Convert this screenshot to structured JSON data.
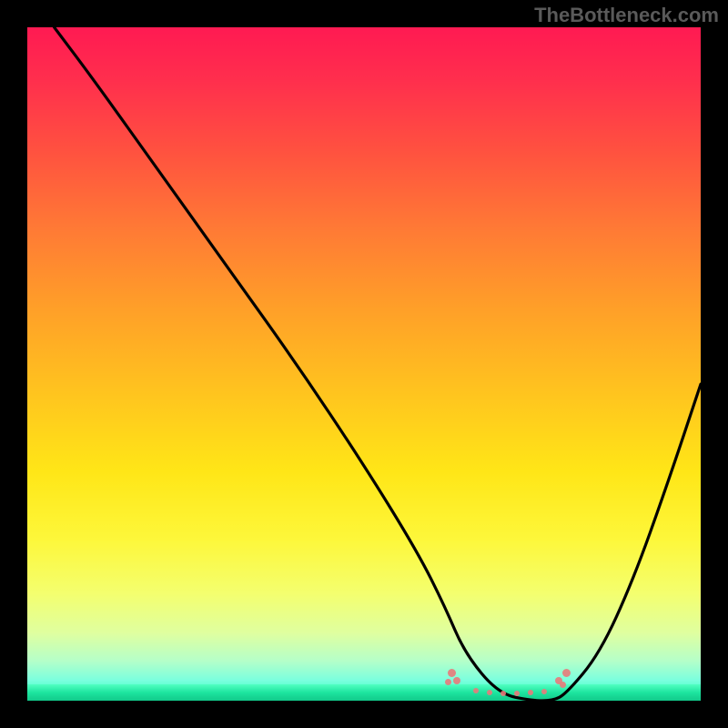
{
  "watermark": "TheBottleneck.com",
  "chart_data": {
    "type": "line",
    "title": "",
    "xlabel": "",
    "ylabel": "",
    "xlim": [
      0,
      100
    ],
    "ylim": [
      0,
      100
    ],
    "grid": false,
    "gradient": {
      "description": "Vertical gradient from red (top, high bottleneck) through orange, yellow to green (bottom, optimal)",
      "stops": [
        {
          "pos": 0,
          "color": "#ff1a52"
        },
        {
          "pos": 18,
          "color": "#ff5040"
        },
        {
          "pos": 42,
          "color": "#ffa028"
        },
        {
          "pos": 66,
          "color": "#ffe617"
        },
        {
          "pos": 84,
          "color": "#f4ff6e"
        },
        {
          "pos": 97,
          "color": "#7affde"
        },
        {
          "pos": 100,
          "color": "#12c98a"
        }
      ]
    },
    "series": [
      {
        "name": "bottleneck-curve",
        "x": [
          4,
          10,
          20,
          30,
          40,
          50,
          58,
          62,
          65,
          70,
          75,
          78,
          80,
          85,
          90,
          95,
          100
        ],
        "y": [
          100,
          92,
          78,
          64,
          50,
          35,
          22,
          14,
          7,
          1,
          0,
          0,
          1,
          7,
          18,
          32,
          47
        ]
      }
    ],
    "valley_flat_range_x": [
      70,
      80
    ],
    "marker_clusters": [
      {
        "name": "left-cluster",
        "x_approx": 64,
        "y_approx": 3
      },
      {
        "name": "right-cluster",
        "x_approx": 80,
        "y_approx": 3
      }
    ]
  }
}
